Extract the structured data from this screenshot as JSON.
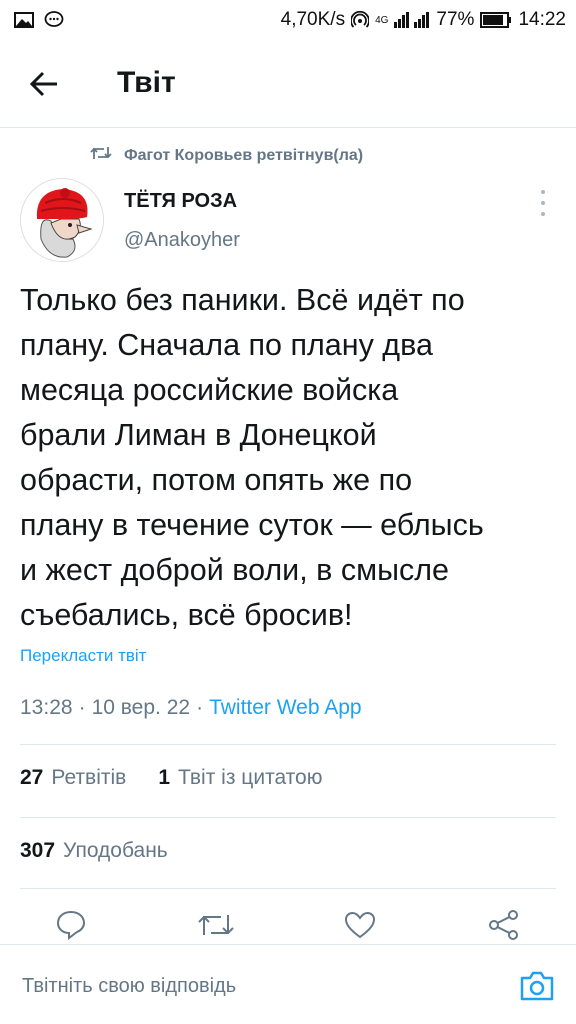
{
  "status_bar": {
    "speed": "4,70K/s",
    "network": "4G",
    "battery": "77%",
    "time": "14:22"
  },
  "header": {
    "title": "Твіт"
  },
  "retweet_context": {
    "text": "Фагот Коровьев ретвітнув(ла)"
  },
  "author": {
    "name": "ТЁТЯ РОЗА",
    "handle": "@Anakoyher"
  },
  "tweet": {
    "lines": [
      "Только без паники. Всё идёт по",
      "плану. Сначала по плану два",
      "месяца российские войска",
      "брали Лиман в Донецкой",
      "обрасти, потом опять же по",
      "плану в течение суток — еблысь",
      "и жест доброй воли, в смысле",
      "съебались, всё бросив!"
    ],
    "translate_label": "Перекласти твіт",
    "time": "13:28",
    "date": "10 вер. 22",
    "source": "Twitter Web App"
  },
  "stats": {
    "retweets_count": "27",
    "retweets_label": "Ретвітів",
    "quotes_count": "1",
    "quotes_label": "Твіт із цитатою",
    "likes_count": "307",
    "likes_label": "Уподобань"
  },
  "reply": {
    "placeholder": "Твітніть свою відповідь"
  },
  "colors": {
    "accent": "#1da1f2",
    "secondary_text": "#657786",
    "avatar_hat": "#e0161b"
  },
  "icons": [
    "image-icon",
    "chat-bubble-icon",
    "hotspot-icon",
    "signal-icon",
    "battery-icon",
    "back-arrow-icon",
    "retweet-icon",
    "more-vertical-icon",
    "reply-icon",
    "like-icon",
    "share-icon",
    "camera-icon"
  ]
}
